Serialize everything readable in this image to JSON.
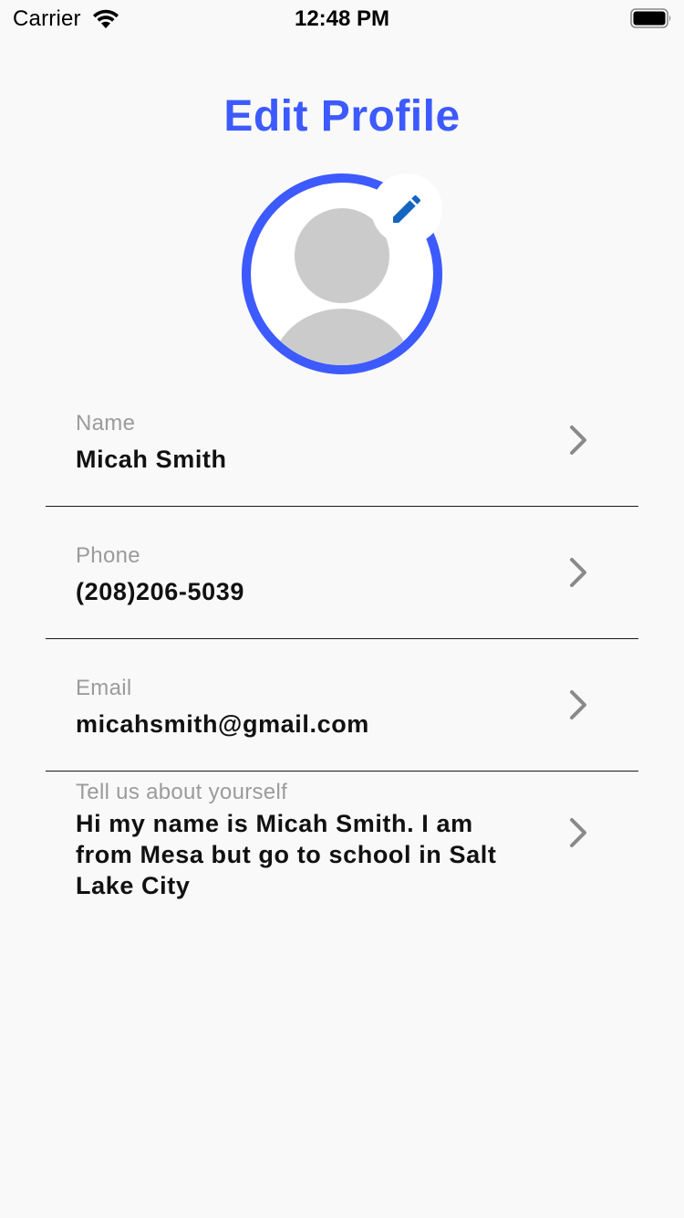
{
  "status_bar": {
    "carrier": "Carrier",
    "time": "12:48 PM",
    "icons": [
      "wifi-icon",
      "battery-icon"
    ]
  },
  "title": "Edit Profile",
  "avatar": {
    "icon": "default-user-avatar",
    "edit_icon": "pencil-icon"
  },
  "colors": {
    "accent": "#3d5afe",
    "label": "#9b9b9b",
    "avatar_placeholder": "#cbcbcb",
    "pencil": "#1565c0"
  },
  "fields": [
    {
      "label": "Name",
      "value": "Micah Smith"
    },
    {
      "label": "Phone",
      "value": "(208)206-5039"
    },
    {
      "label": "Email",
      "value": "micahsmith@gmail.com"
    },
    {
      "label": "Tell us about yourself",
      "value": "Hi my name is Micah Smith. I am from Mesa but go to school in Salt Lake City"
    }
  ]
}
